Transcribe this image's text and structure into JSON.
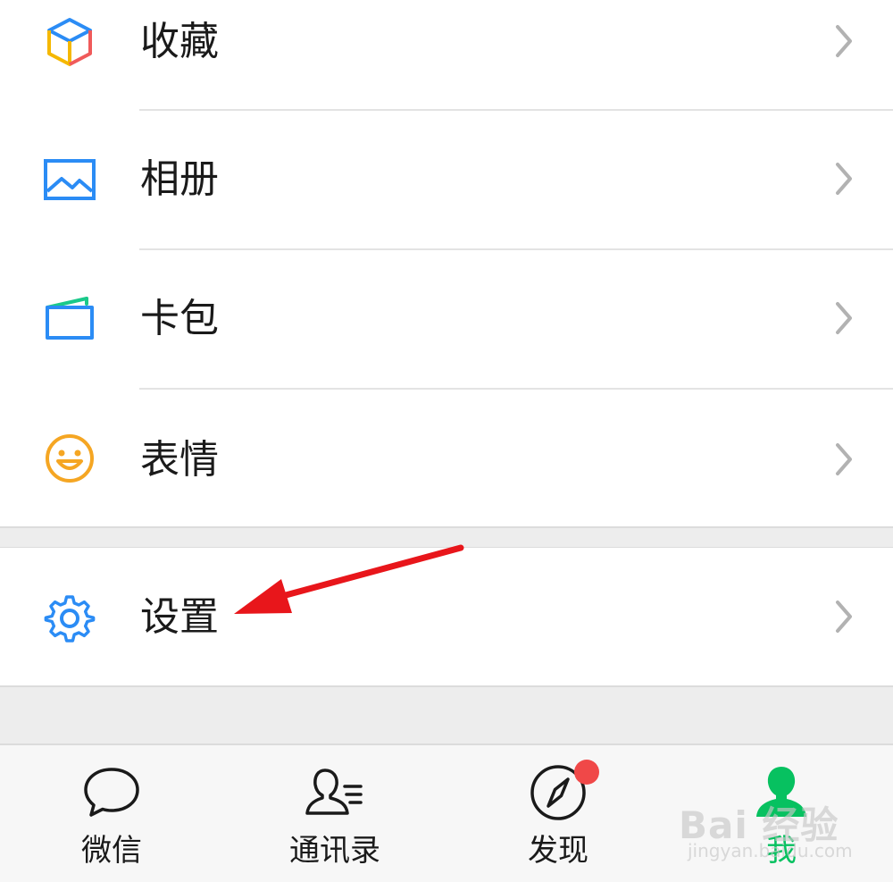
{
  "menu": {
    "items": [
      {
        "label": "收藏",
        "icon": "favorites-cube-icon"
      },
      {
        "label": "相册",
        "icon": "album-picture-icon"
      },
      {
        "label": "卡包",
        "icon": "card-wallet-icon"
      },
      {
        "label": "表情",
        "icon": "sticker-smile-icon"
      }
    ],
    "settings": {
      "label": "设置",
      "icon": "gear-icon"
    }
  },
  "tabbar": {
    "tabs": [
      {
        "label": "微信",
        "icon": "chat-bubble-icon",
        "active": false
      },
      {
        "label": "通讯录",
        "icon": "contacts-icon",
        "active": false
      },
      {
        "label": "发现",
        "icon": "compass-icon",
        "active": false,
        "badge": true
      },
      {
        "label": "我",
        "icon": "me-person-icon",
        "active": true
      }
    ]
  },
  "watermark": {
    "text": "Bai 经验",
    "sub": "jingyan.baidu.com"
  },
  "colors": {
    "accent_green": "#07c160",
    "badge_red": "#f04848",
    "annotation_red": "#e8161b",
    "icon_blue": "#2b8cf5"
  }
}
